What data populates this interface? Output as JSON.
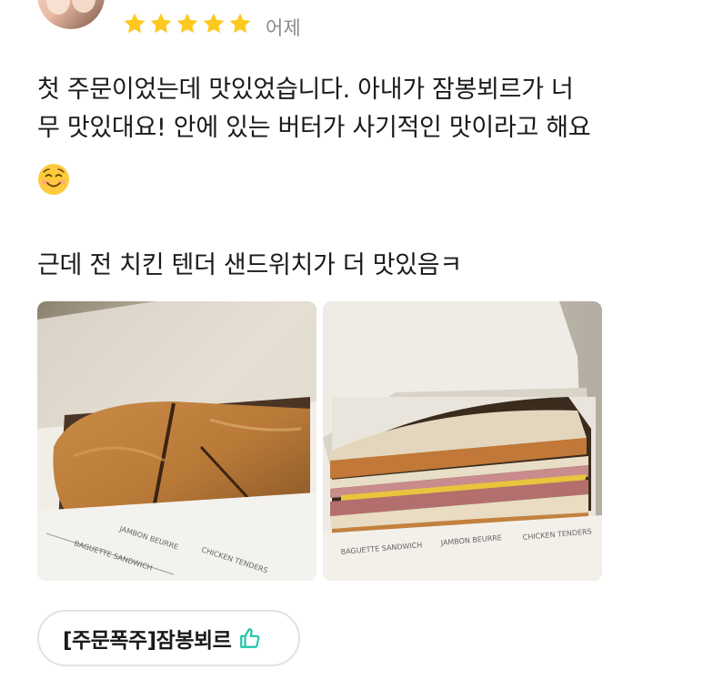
{
  "review": {
    "rating": 5,
    "date": "어제",
    "lines": [
      "첫 주문이었는데 맛있었습니다. 아내가 잠봉뵈르가 너",
      "무 맛있대요! 안에 있는 버터가 사기적인 맛이라고 해요"
    ],
    "emoji": "smiling-face-icon",
    "line2": "근데 전 치킨 텐더 샌드위치가 더 맛있음ㅋ"
  },
  "menu_chip": {
    "label": "[주문폭주]잠봉뵈르",
    "icon": "thumbs-up-icon"
  },
  "colors": {
    "star": "#ffc81e",
    "accent": "#1fc5a8"
  }
}
